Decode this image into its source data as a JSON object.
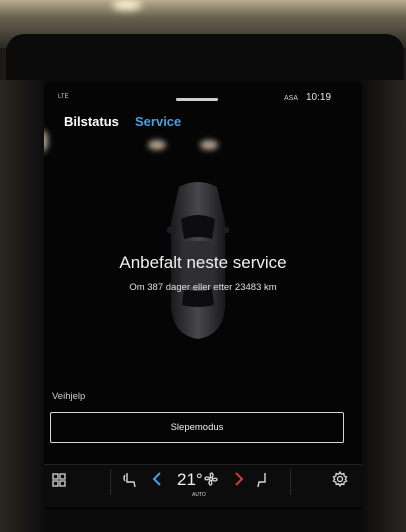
{
  "status_bar": {
    "signal": "LTE",
    "driver_assist": "ASA",
    "time": "10:19"
  },
  "tabs": [
    {
      "label": "Bilstatus"
    },
    {
      "label": "Service"
    }
  ],
  "service": {
    "title": "Anbefalt neste service",
    "detail": "Om 387 dager eller etter 23483 km"
  },
  "roadside": {
    "heading": "Veihjelp",
    "tow_button": "Slepemodus"
  },
  "climate": {
    "temperature": "21°",
    "fan_mode": "AUTO"
  },
  "colors": {
    "accent": "#4a9fdc",
    "background": "#050506",
    "hazard": "#d33b3b"
  },
  "icons": [
    "apps-grid-icon",
    "seat-heat-icon",
    "chevron-left-icon",
    "fan-icon",
    "chevron-right-icon",
    "seat-ventilation-icon",
    "settings-gear-icon"
  ]
}
